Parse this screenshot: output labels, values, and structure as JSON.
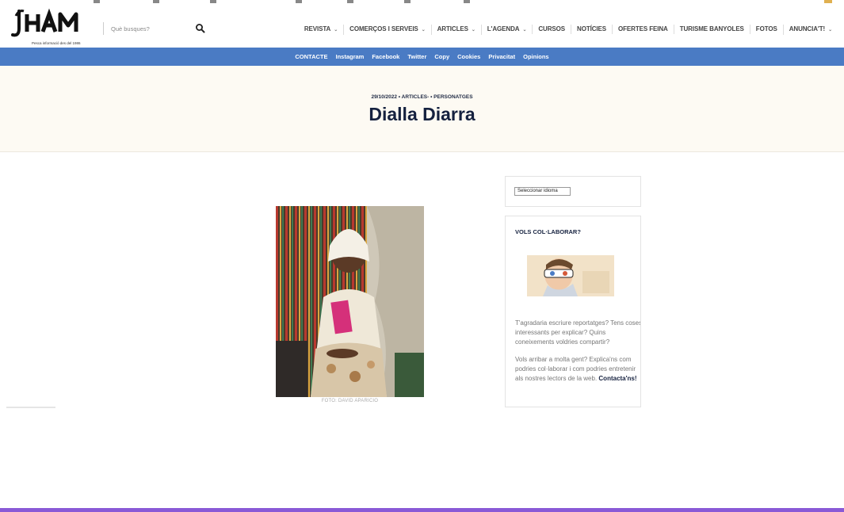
{
  "header": {
    "logo_text": "L'HAM",
    "logo_tagline": "Pesca informació des del 1986",
    "search_placeholder": "Què busques?"
  },
  "main_nav": [
    {
      "label": "REVISTA",
      "dropdown": true
    },
    {
      "label": "COMERÇOS I SERVEIS",
      "dropdown": true
    },
    {
      "label": "ARTICLES",
      "dropdown": true
    },
    {
      "label": "L'AGENDA",
      "dropdown": true
    },
    {
      "label": "CURSOS",
      "dropdown": false
    },
    {
      "label": "NOTÍCIES",
      "dropdown": false
    },
    {
      "label": "OFERTES FEINA",
      "dropdown": false
    },
    {
      "label": "TURISME BANYOLES",
      "dropdown": false
    },
    {
      "label": "FOTOS",
      "dropdown": false
    },
    {
      "label": "ANUNCIA'T!",
      "dropdown": true
    }
  ],
  "dropdown_caret": "⌄",
  "sub_nav": [
    "CONTACTE",
    "Instagram",
    "Facebook",
    "Twitter",
    "Copy",
    "Cookies",
    "Privacitat",
    "Opinions"
  ],
  "article": {
    "meta": "29/10/2022 • ARTICLES- • PERSONATGES",
    "title": "Dialla Diarra",
    "photo_caption": "FOTO: DAVID APARICIO"
  },
  "sidebar": {
    "language_select": "Seleccionar idioma",
    "collab_title": "VOLS COL·LABORAR?",
    "collab_paragraph1": "T'agradaria escriure reportatges? Tens coses interessants per explicar? Quins coneixements voldries compartir?",
    "collab_paragraph2": "Vols arribar a molta gent? Explica'ns com podries col·laborar i com podries entretenir als nostres lectors de la web.",
    "collab_cta": "Contacta'ns!"
  },
  "colors": {
    "blue_bar": "#4a7bc4",
    "hero_bg": "#fdfaf3",
    "title": "#15213f",
    "bottom_bar": "#8a59d6"
  }
}
